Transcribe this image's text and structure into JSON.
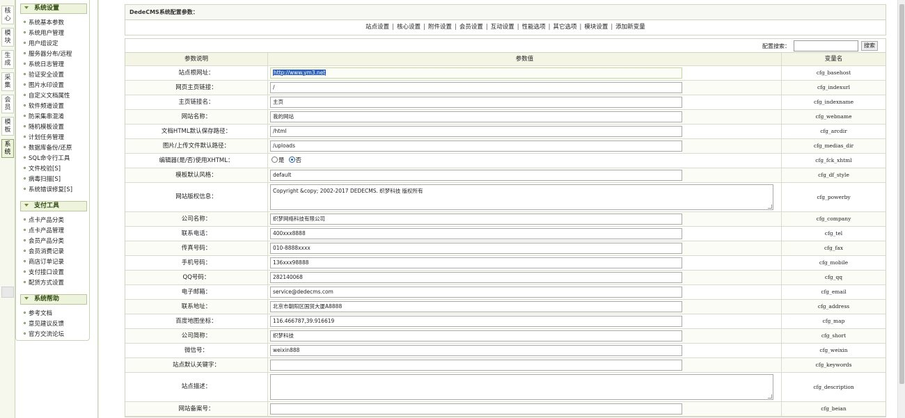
{
  "vtabs": [
    {
      "label": "核心",
      "active": false
    },
    {
      "label": "模块",
      "active": false
    },
    {
      "label": "生成",
      "active": false
    },
    {
      "label": "采集",
      "active": false
    },
    {
      "label": "会员",
      "active": false
    },
    {
      "label": "模板",
      "active": false
    },
    {
      "label": "系统",
      "active": true
    }
  ],
  "menu": {
    "groups": [
      {
        "title": "系统设置",
        "items": [
          "系统基本参数",
          "系统用户管理",
          "用户组设定",
          "服务器分布/远程",
          "系统日志管理",
          "验证安全设置",
          "图片水印设置",
          "自定义文档属性",
          "软件频道设置",
          "防采集串混淆",
          "随机模板设置",
          "计划任务管理",
          "数据库备份/还原",
          "SQL命令行工具",
          "文件校验[S]",
          "病毒扫描[S]",
          "系统错误修复[S]"
        ]
      },
      {
        "title": "支付工具",
        "items": [
          "点卡产品分类",
          "点卡产品管理",
          "会员产品分类",
          "会员消费记录",
          "商店订单记录",
          "支付接口设置",
          "配货方式设置"
        ]
      },
      {
        "title": "系统帮助",
        "items": [
          "参考文档",
          "意见建议反馈",
          "官方交流论坛"
        ]
      }
    ]
  },
  "config": {
    "header": "DedeCMS系统配置参数：",
    "tabs": [
      "站点设置",
      "核心设置",
      "附件设置",
      "会员设置",
      "互动设置",
      "性能选项",
      "其它选项",
      "模块设置",
      "添加新变量"
    ],
    "search_label": "配置搜索：",
    "search_value": "",
    "search_button": "搜索",
    "columns": [
      "参数说明",
      "参数值",
      "变量名"
    ],
    "rows": [
      {
        "label": "站点根网址：",
        "type": "input",
        "value": "http://www.ym3.net",
        "var": "cfg_basehost"
      },
      {
        "label": "网页主页链接：",
        "type": "input",
        "value": "/",
        "var": "cfg_indexurl"
      },
      {
        "label": "主页链接名：",
        "type": "input",
        "value": "主页",
        "var": "cfg_indexname"
      },
      {
        "label": "网站名称：",
        "type": "input",
        "value": "我的网站",
        "var": "cfg_webname"
      },
      {
        "label": "文档HTML默认保存路径：",
        "type": "input",
        "value": "/html",
        "var": "cfg_arcdir"
      },
      {
        "label": "图片/上传文件默认路径：",
        "type": "input",
        "value": "/uploads",
        "var": "cfg_medias_dir"
      },
      {
        "label": "编辑器(是/否)使用XHTML：",
        "type": "radio",
        "options": [
          "是",
          "否"
        ],
        "selected": "否",
        "var": "cfg_fck_xhtml"
      },
      {
        "label": "模板默认风格：",
        "type": "input",
        "value": "default",
        "var": "cfg_df_style"
      },
      {
        "label": "网站版权信息：",
        "type": "textarea",
        "value": "Copyright &copy; 2002-2017 DEDECMS. 织梦科技 版权所有",
        "var": "cfg_powerby"
      },
      {
        "label": "公司名称：",
        "type": "input",
        "value": "织梦网络科技有限公司",
        "var": "cfg_company"
      },
      {
        "label": "联系电话：",
        "type": "input",
        "value": "400xxx8888",
        "var": "cfg_tel"
      },
      {
        "label": "传真号码：",
        "type": "input",
        "value": "010-8888xxxx",
        "var": "cfg_fax"
      },
      {
        "label": "手机号码：",
        "type": "input",
        "value": "136xxx98888",
        "var": "cfg_mobile"
      },
      {
        "label": "QQ号码：",
        "type": "input",
        "value": "282140068",
        "var": "cfg_qq"
      },
      {
        "label": "电子邮箱：",
        "type": "input",
        "value": "service@dedecms.com",
        "var": "cfg_email"
      },
      {
        "label": "联系地址：",
        "type": "input",
        "value": "北京市朝阳区国贸大厦A8888",
        "var": "cfg_address"
      },
      {
        "label": "百度地图坐标：",
        "type": "input",
        "value": "116.466787,39.916619",
        "var": "cfg_map"
      },
      {
        "label": "公司简称：",
        "type": "input",
        "value": "织梦科技",
        "var": "cfg_short"
      },
      {
        "label": "微信号：",
        "type": "input",
        "value": "weixin888",
        "var": "cfg_weixin"
      },
      {
        "label": "站点默认关键字：",
        "type": "input",
        "value": "",
        "var": "cfg_keywords"
      },
      {
        "label": "站点描述：",
        "type": "textarea",
        "value": "",
        "var": "cfg_description"
      },
      {
        "label": "网站备案号：",
        "type": "input",
        "value": "",
        "var": "cfg_beian"
      }
    ]
  },
  "colors": {
    "accent": "#2f4d0e",
    "header_bg": "#f4f5e4",
    "selection": "#2a5fbf"
  }
}
